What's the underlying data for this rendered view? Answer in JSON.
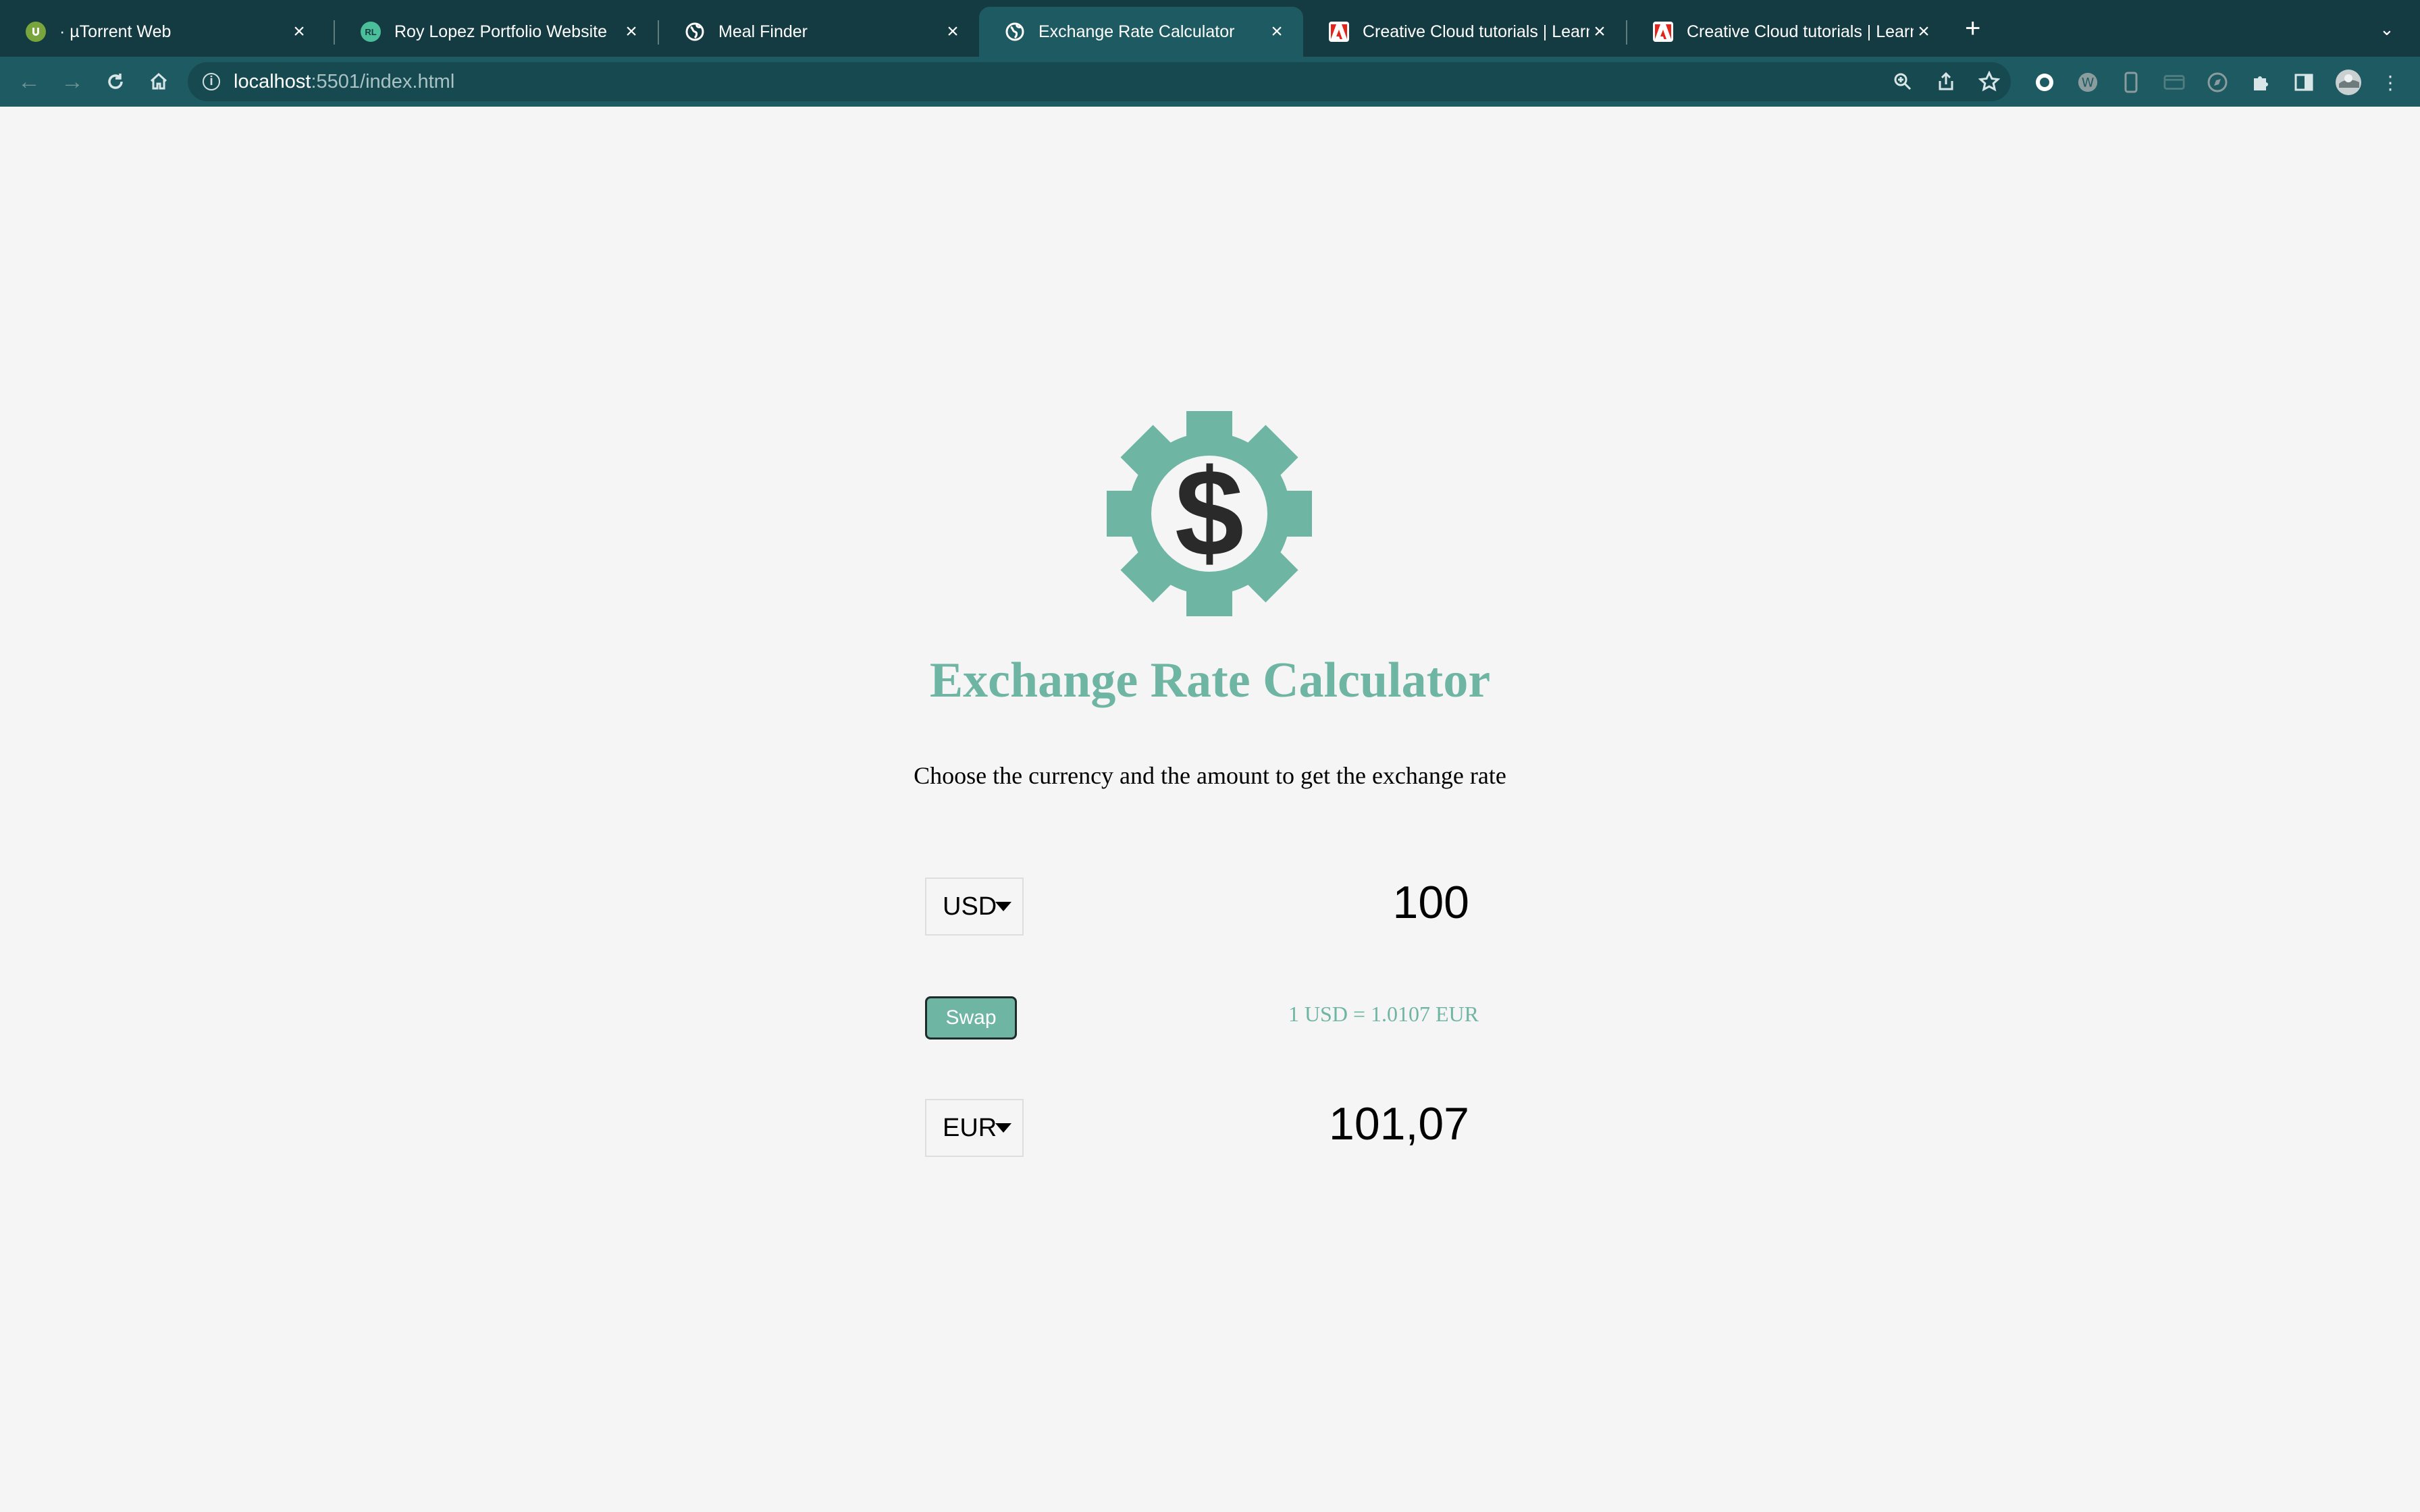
{
  "browser": {
    "tabs": [
      {
        "title": "· µTorrent Web",
        "icon": "utorrent-icon",
        "active": false
      },
      {
        "title": "Roy Lopez Portfolio Website",
        "icon": "rl-logo-icon",
        "active": false
      },
      {
        "title": "Meal Finder",
        "icon": "globe-icon",
        "active": false
      },
      {
        "title": "Exchange Rate Calculator",
        "icon": "globe-icon",
        "active": true
      },
      {
        "title": "Creative Cloud tutorials | Learn",
        "icon": "adobe-icon",
        "active": false
      },
      {
        "title": "Creative Cloud tutorials | Learn",
        "icon": "adobe-icon",
        "active": false
      }
    ],
    "url_host": "localhost",
    "url_path": ":5501/index.html"
  },
  "app": {
    "title": "Exchange Rate Calculator",
    "subtitle": "Choose the currency and the amount to get the exchange rate",
    "currency_one": {
      "code": "USD",
      "amount": "100"
    },
    "currency_two": {
      "code": "EUR",
      "amount": "101,07"
    },
    "swap_label": "Swap",
    "rate_text": "1 USD = 1.0107 EUR",
    "colors": {
      "accent": "#6fb5a3",
      "chrome": "#143b42",
      "toolbar": "#1e5a61",
      "background": "#f5f5f5"
    }
  }
}
